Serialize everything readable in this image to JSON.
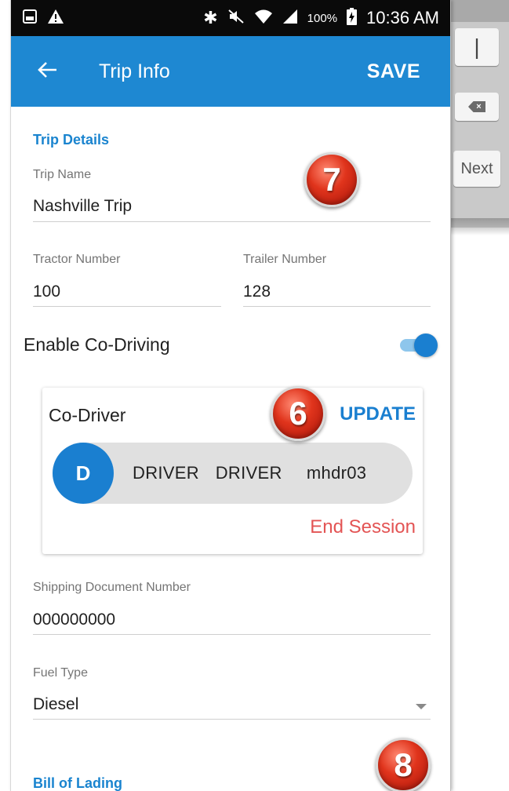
{
  "status_bar": {
    "battery_pct": "100%",
    "time": "10:36 AM"
  },
  "app_bar": {
    "title": "Trip Info",
    "save_label": "SAVE"
  },
  "trip_details": {
    "section_title": "Trip Details",
    "trip_name": {
      "label": "Trip Name",
      "value": "Nashville Trip"
    },
    "tractor_number": {
      "label": "Tractor Number",
      "value": "100"
    },
    "trailer_number": {
      "label": "Trailer Number",
      "value": "128"
    }
  },
  "co_driving": {
    "toggle_label": "Enable Co-Driving",
    "enabled": true,
    "card_title": "Co-Driver",
    "update_label": "UPDATE",
    "driver_initial": "D",
    "driver_name": "DRIVER  DRIVER   mhdr03",
    "end_session_label": "End Session"
  },
  "shipping_document": {
    "label": "Shipping Document Number",
    "value": "000000000"
  },
  "fuel_type": {
    "label": "Fuel Type",
    "value": "Diesel"
  },
  "bill_of_lading": {
    "section_title": "Bill of Lading"
  },
  "callouts": [
    "7",
    "6",
    "8"
  ],
  "keyboard": {
    "key_partial": "|",
    "next_label": "Next"
  },
  "colors": {
    "app_bar": "#1e88d2",
    "accent": "#1a7fd0",
    "section_title": "#1a84cf",
    "end_session": "#e35454",
    "chip_bg": "#e0e0e0",
    "callout_red": "#e0341c"
  },
  "icons": {
    "back": "arrow-left-icon",
    "dropdown": "triangle-down-icon",
    "delete_key": "backspace-icon"
  }
}
